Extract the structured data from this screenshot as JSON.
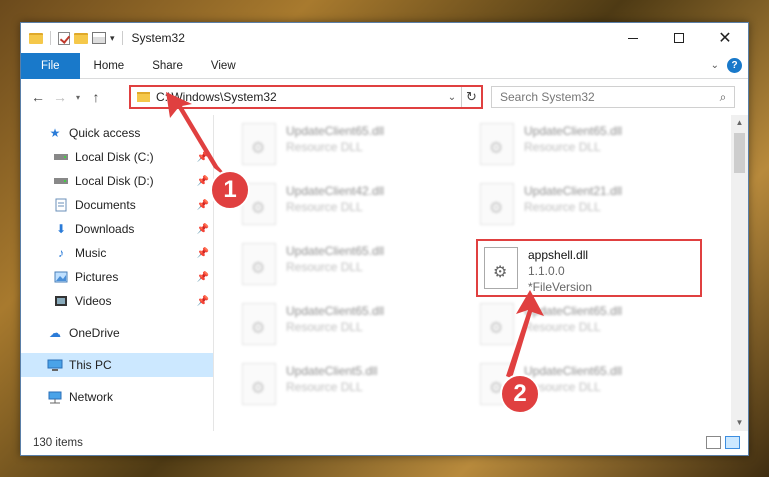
{
  "window": {
    "title": "System32",
    "controls": {
      "minimize": "—",
      "maximize": "",
      "close": "✕"
    }
  },
  "ribbon": {
    "tabs": [
      "File",
      "Home",
      "Share",
      "View"
    ],
    "collapse_icon": "chevron-down-icon",
    "help_label": "?"
  },
  "navigation": {
    "address": "C:\\Windows\\System32",
    "search_placeholder": "Search System32"
  },
  "sidebar": {
    "items": [
      {
        "label": "Quick access",
        "icon": "star-icon",
        "pinned": false
      },
      {
        "label": "Local Disk (C:)",
        "icon": "drive-icon",
        "pinned": true
      },
      {
        "label": "Local Disk (D:)",
        "icon": "drive-icon",
        "pinned": true
      },
      {
        "label": "Documents",
        "icon": "documents-icon",
        "pinned": true
      },
      {
        "label": "Downloads",
        "icon": "download-icon",
        "pinned": true
      },
      {
        "label": "Music",
        "icon": "music-icon",
        "pinned": true
      },
      {
        "label": "Pictures",
        "icon": "pictures-icon",
        "pinned": true
      },
      {
        "label": "Videos",
        "icon": "videos-icon",
        "pinned": true
      },
      {
        "label": "OneDrive",
        "icon": "cloud-icon",
        "pinned": false
      },
      {
        "label": "This PC",
        "icon": "computer-icon",
        "pinned": false
      },
      {
        "label": "Network",
        "icon": "network-icon",
        "pinned": false
      }
    ]
  },
  "files": [
    {
      "name": "UpdateClient65.dll",
      "desc": "Resource DLL"
    },
    {
      "name": "UpdateClient65.dll",
      "desc": "Resource DLL"
    },
    {
      "name": "UpdateClient42.dll",
      "desc": "Resource DLL"
    },
    {
      "name": "UpdateClient21.dll",
      "desc": "Resource DLL"
    },
    {
      "name": "UpdateClient65.dll",
      "desc": "Resource DLL"
    },
    {
      "name": "appshell.dll",
      "desc": "1.1.0.0",
      "desc2": "*FileVersion"
    },
    {
      "name": "UpdateClient65.dll",
      "desc": "Resource DLL"
    },
    {
      "name": "UpdateClient65.dll",
      "desc": "Resource DLL"
    },
    {
      "name": "UpdateClient5.dll",
      "desc": "Resource DLL"
    },
    {
      "name": "UpdateClient65.dll",
      "desc": "Resource DLL"
    }
  ],
  "status": {
    "item_count": "130 items"
  },
  "annotations": {
    "step1": "1",
    "step2": "2",
    "color": "#e04040"
  }
}
